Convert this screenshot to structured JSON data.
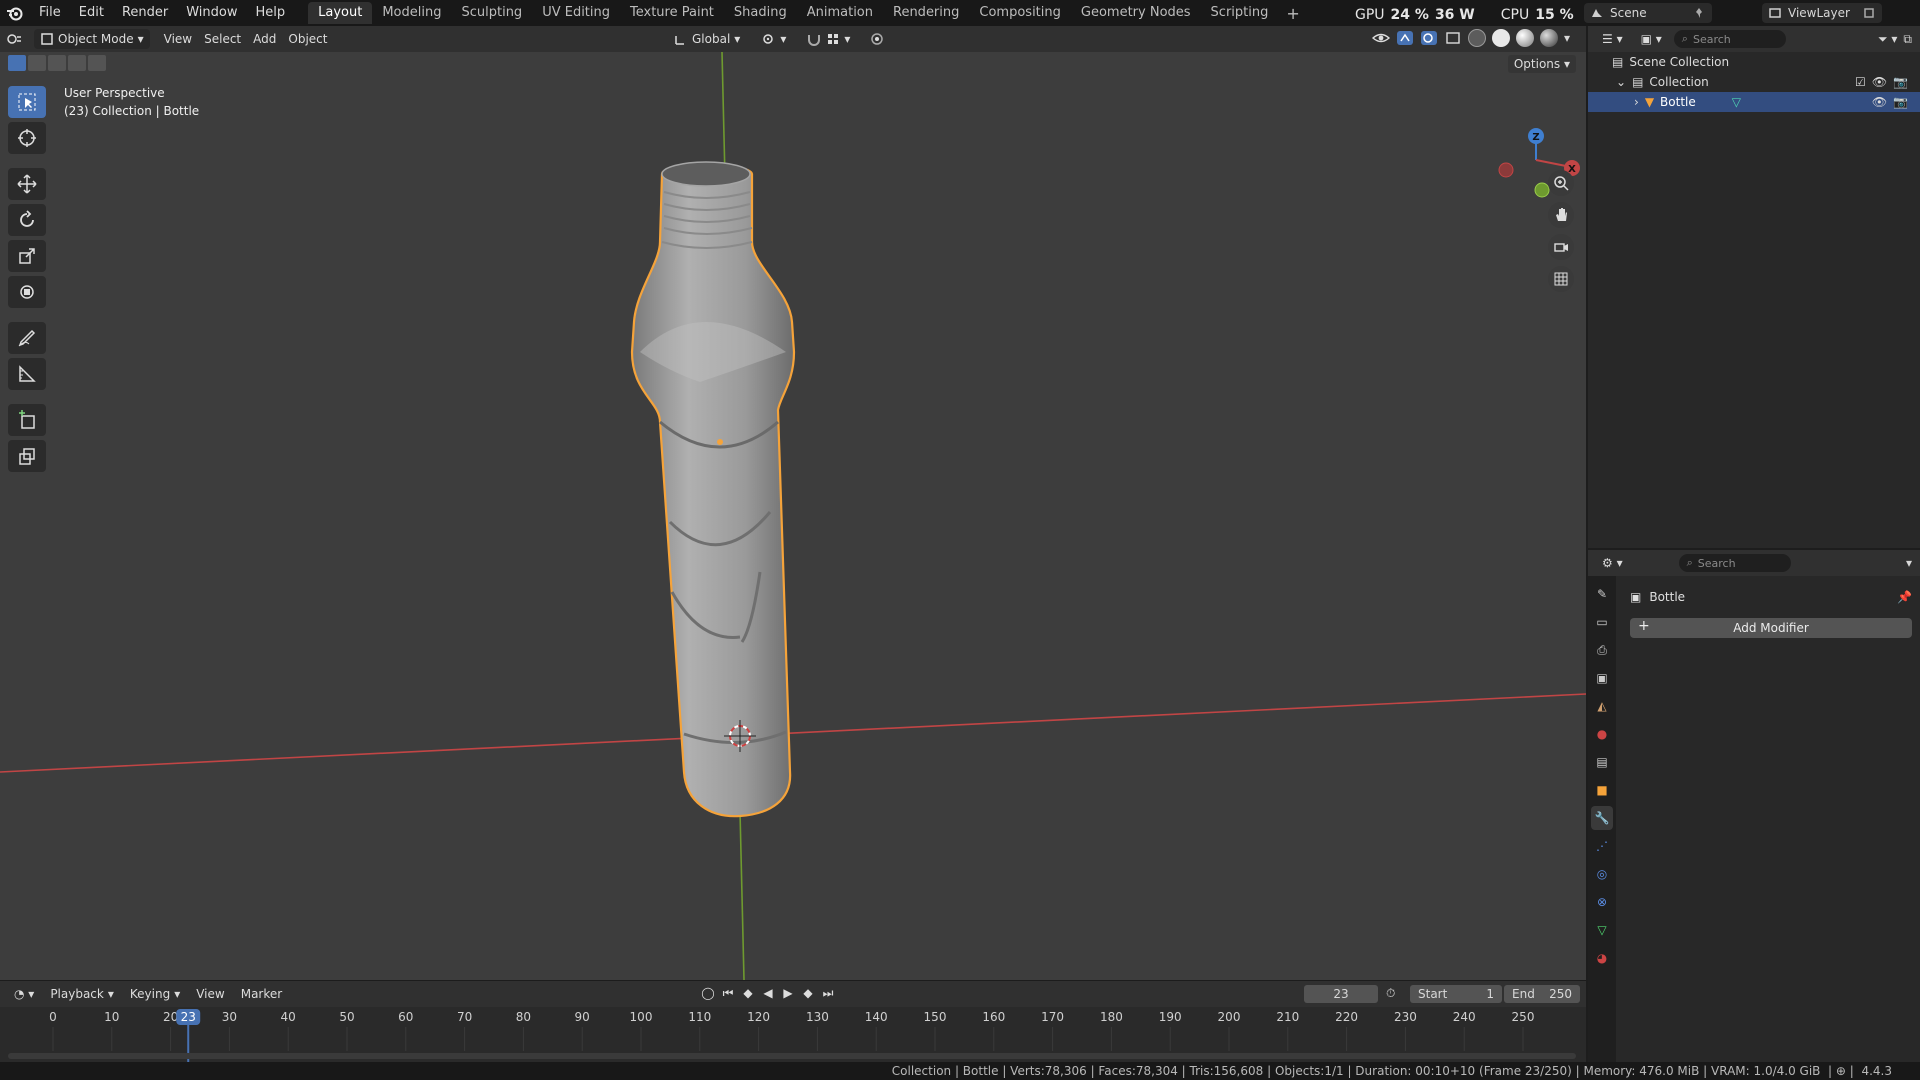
{
  "topbar": {
    "menus": [
      "File",
      "Edit",
      "Render",
      "Window",
      "Help"
    ],
    "workspaces": [
      "Layout",
      "Modeling",
      "Sculpting",
      "UV Editing",
      "Texture Paint",
      "Shading",
      "Animation",
      "Rendering",
      "Compositing",
      "Geometry Nodes",
      "Scripting"
    ],
    "active_workspace": "Layout",
    "gpu_label": "GPU",
    "gpu_value": "24 %",
    "gpu_power": "36 W",
    "cpu_label": "CPU",
    "cpu_value": "15 %",
    "scene": "Scene",
    "view_layer": "ViewLayer"
  },
  "viewport_header": {
    "mode": "Object Mode",
    "menus": [
      "View",
      "Select",
      "Add",
      "Object"
    ],
    "orientation": "Global",
    "options": "Options"
  },
  "viewport": {
    "perspective": "User Perspective",
    "context": "(23) Collection | Bottle",
    "gizmo": {
      "z": "Z",
      "x": "X"
    },
    "colors": {
      "background": "#3d3d3d",
      "x_axis": "#c14545",
      "y_axis": "#6e9a2f",
      "selection": "#f5a33a",
      "active_tool": "#4772b3"
    }
  },
  "timeline": {
    "menus": [
      "Playback",
      "Keying",
      "View",
      "Marker"
    ],
    "current_frame": "23",
    "start_label": "Start",
    "start_value": "1",
    "end_label": "End",
    "end_value": "250",
    "ticks": [
      "0",
      "10",
      "20",
      "30",
      "40",
      "50",
      "60",
      "70",
      "80",
      "90",
      "100",
      "110",
      "120",
      "130",
      "140",
      "150",
      "160",
      "170",
      "180",
      "190",
      "200",
      "210",
      "220",
      "230",
      "240",
      "250"
    ]
  },
  "outliner": {
    "search_placeholder": "Search",
    "rows": [
      "Scene Collection",
      "Collection",
      "Bottle"
    ]
  },
  "properties": {
    "search_placeholder": "Search",
    "object_name": "Bottle",
    "add_modifier": "Add Modifier"
  },
  "statusbar": {
    "text": "Collection | Bottle | Verts:78,306 | Faces:78,304 | Tris:156,608 | Objects:1/1 | Duration: 00:10+10 (Frame 23/250) | Memory: 476.0 MiB | VRAM: 1.0/4.0 GiB",
    "version": "4.4.3"
  }
}
